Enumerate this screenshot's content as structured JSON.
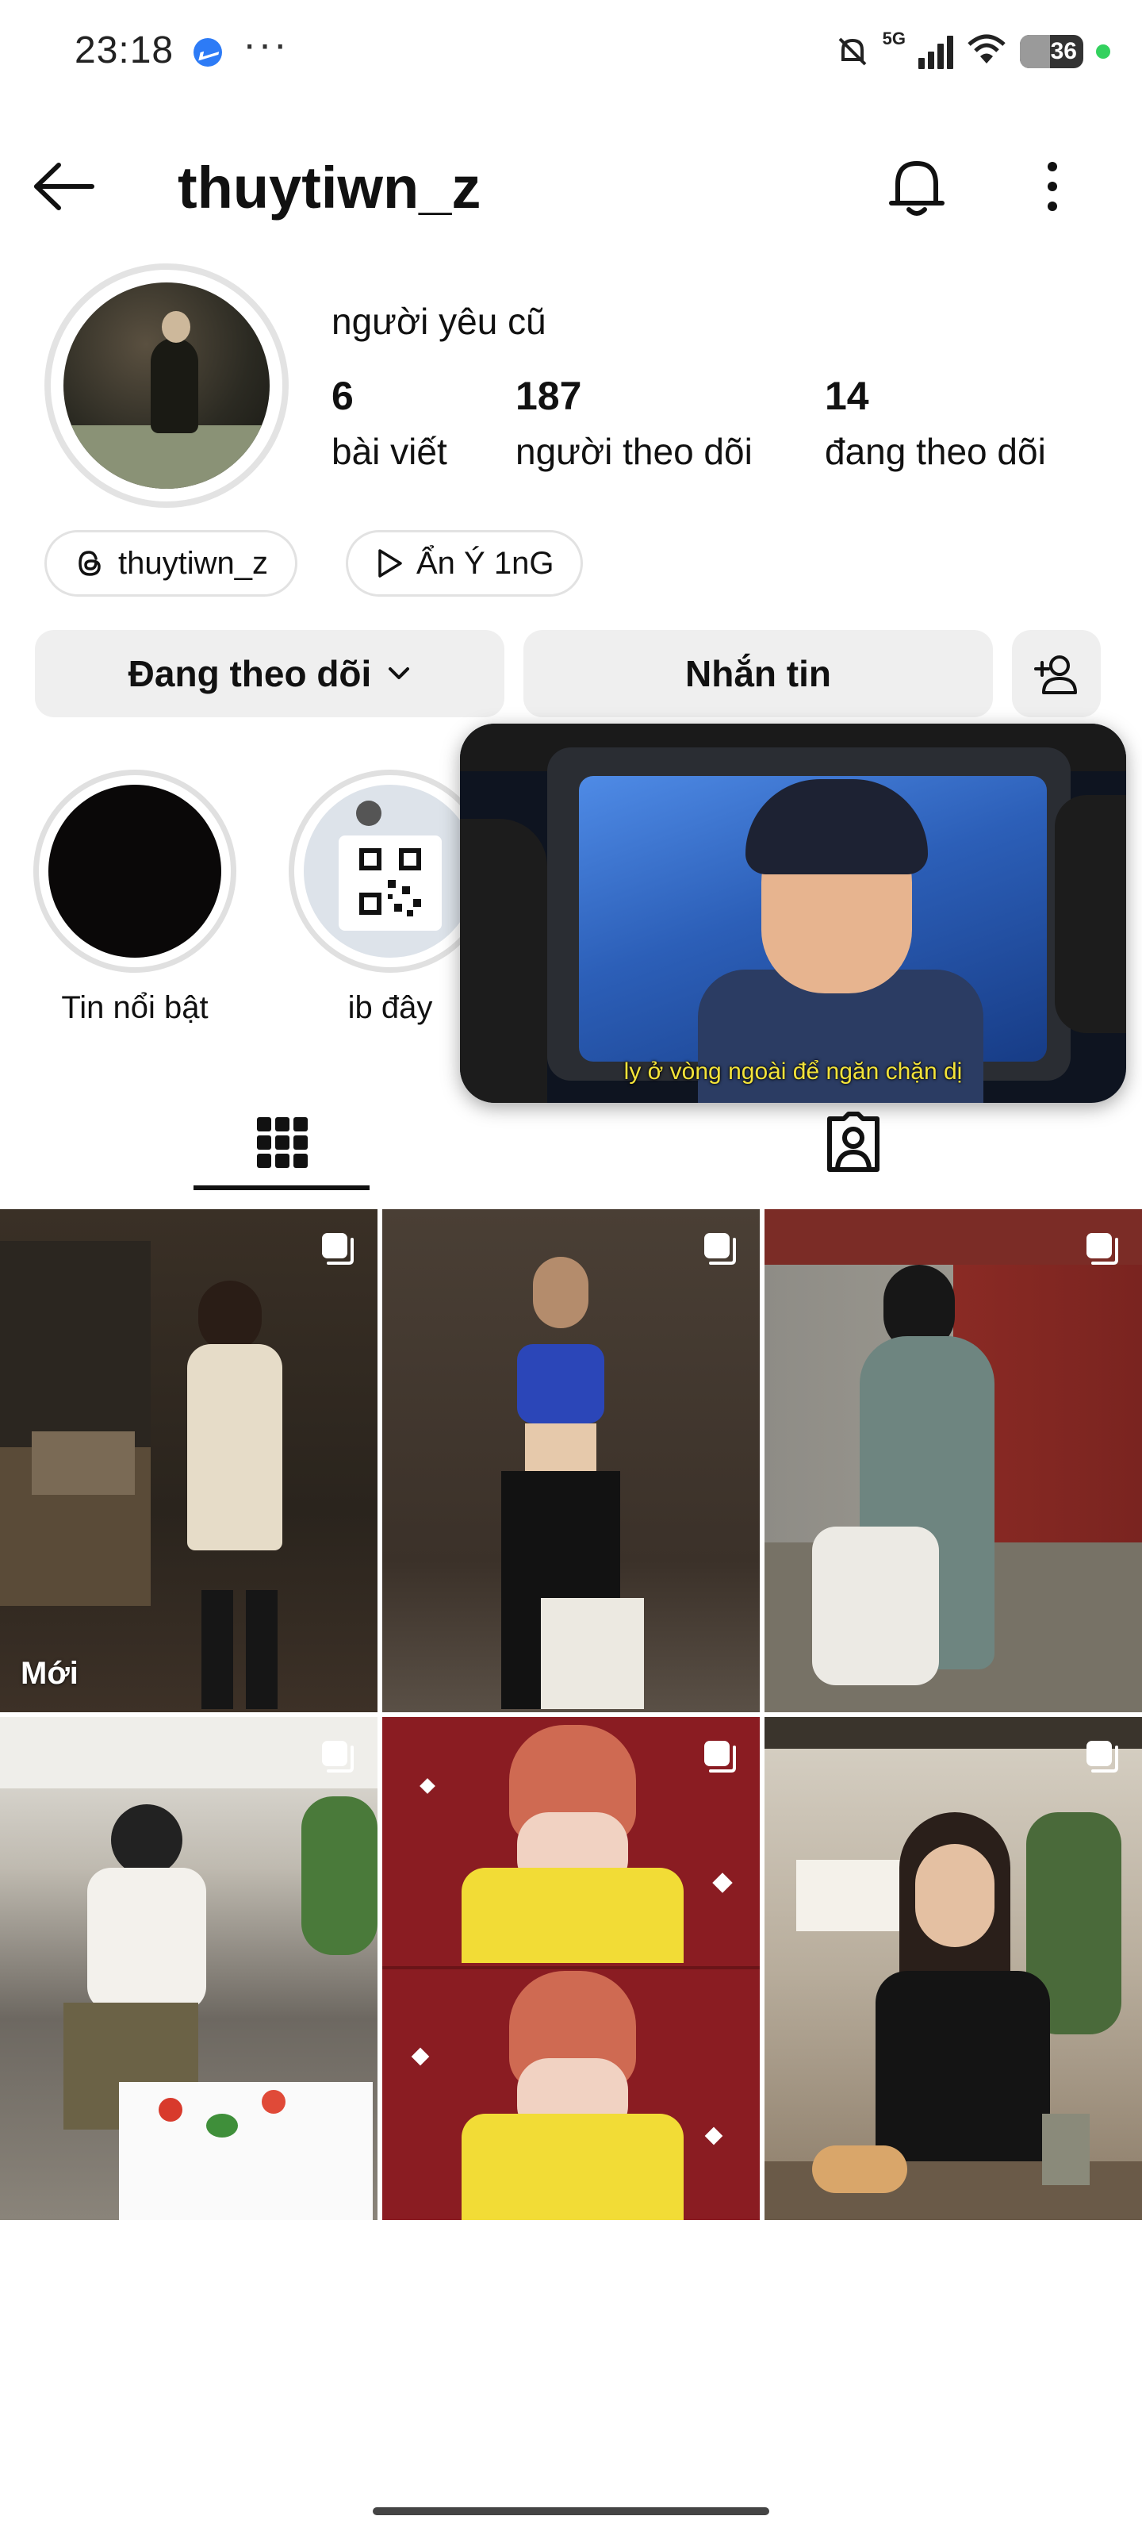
{
  "status_bar": {
    "time": "23:18",
    "network": "5G",
    "battery": "36",
    "icons": [
      "messenger-icon",
      "more-dots-icon",
      "mute-icon",
      "signal-icon",
      "wifi-icon",
      "battery-icon"
    ]
  },
  "header": {
    "username": "thuytiwn_z"
  },
  "profile": {
    "display_name": "người yêu cũ",
    "stats": [
      {
        "value": "6",
        "label": "bài viết"
      },
      {
        "value": "187",
        "label": "người theo dõi"
      },
      {
        "value": "14",
        "label": "đang theo dõi"
      }
    ],
    "pills": [
      {
        "icon": "threads-icon",
        "label": "thuytiwn_z"
      },
      {
        "icon": "play-icon",
        "label": "Ẩn Ý 1nG"
      }
    ]
  },
  "actions": {
    "following_label": "Đang theo dõi",
    "message_label": "Nhắn tin"
  },
  "highlights": [
    {
      "label": "Tin nổi bật"
    },
    {
      "label": "ib đây"
    }
  ],
  "pip_video": {
    "subtitle": "ly ở vòng ngoài để ngăn chặn dị"
  },
  "grid": {
    "badge_new": "Mới",
    "post_count": 6
  },
  "colors": {
    "button_bg": "#efefef",
    "pill_border": "#e2e2e2",
    "status_dot": "#33d15e",
    "subtitle": "#f3e33a"
  }
}
